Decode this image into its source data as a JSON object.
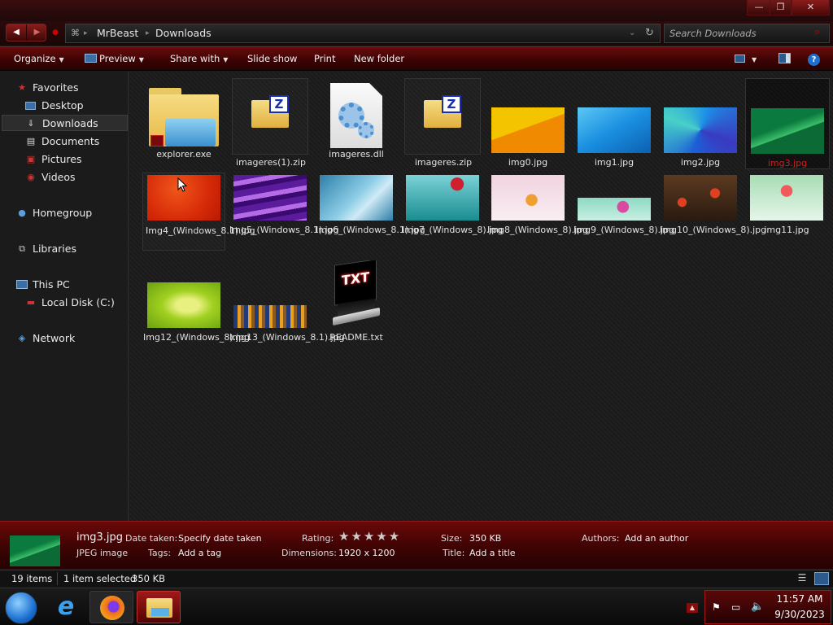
{
  "window": {
    "minimize_label": "—",
    "maximize_label": "❐",
    "close_label": "✕"
  },
  "address": {
    "crumbs": [
      "MrBeast",
      "Downloads"
    ],
    "search_placeholder": "Search Downloads"
  },
  "toolbar": {
    "organize": "Organize",
    "preview": "Preview",
    "share_with": "Share with",
    "slide_show": "Slide show",
    "print": "Print",
    "new_folder": "New folder"
  },
  "nav": {
    "favorites": "Favorites",
    "desktop": "Desktop",
    "downloads": "Downloads",
    "documents": "Documents",
    "pictures": "Pictures",
    "videos": "Videos",
    "homegroup": "Homegroup",
    "libraries": "Libraries",
    "this_pc": "This PC",
    "local_disk": "Local Disk (C:)",
    "network": "Network"
  },
  "files": [
    {
      "name": "explorer.exe",
      "kind": "folder-icon"
    },
    {
      "name": "imageres(1).zip",
      "kind": "zip-icon"
    },
    {
      "name": "imageres.dll",
      "kind": "dll-icon"
    },
    {
      "name": "imageres.zip",
      "kind": "zip-icon"
    },
    {
      "name": "img0.jpg",
      "kind": "image",
      "colors": [
        "#f5c400",
        "#f08a00"
      ]
    },
    {
      "name": "img1.jpg",
      "kind": "image",
      "colors": [
        "#1a8fe0",
        "#5cc8f5"
      ]
    },
    {
      "name": "img2.jpg",
      "kind": "image",
      "colors": [
        "#1c5fd6",
        "#49d0c7"
      ]
    },
    {
      "name": "img3.jpg",
      "kind": "image",
      "colors": [
        "#0b7a3e",
        "#3bbf6a"
      ]
    },
    {
      "name": "Img4_(Windows_8.1).jpg",
      "kind": "image",
      "colors": [
        "#d62a08",
        "#f0561a"
      ]
    },
    {
      "name": "Img5_(Windows_8.1).jpg",
      "kind": "image",
      "colors": [
        "#5a1c9c",
        "#b56be6"
      ]
    },
    {
      "name": "Img6_(Windows_8.1).jpg",
      "kind": "image",
      "colors": [
        "#8fcfe8",
        "#2e7fa8"
      ]
    },
    {
      "name": "Img7_(Windows_8).jpg",
      "kind": "image",
      "colors": [
        "#1a8c90",
        "#7bd2d6"
      ]
    },
    {
      "name": "Img8_(Windows_8).jpg",
      "kind": "image",
      "colors": [
        "#f2d3e0",
        "#f0a030"
      ]
    },
    {
      "name": "Img9_(Windows_8).jpg",
      "kind": "image",
      "colors": [
        "#8fd9c4",
        "#d84aa0"
      ]
    },
    {
      "name": "Img10_(Windows_8).jpg",
      "kind": "image",
      "colors": [
        "#5c3a20",
        "#b83018"
      ]
    },
    {
      "name": "img11.jpg",
      "kind": "image",
      "colors": [
        "#d0ecd8",
        "#f05a5a"
      ]
    },
    {
      "name": "Img12_(Windows_8).jpg",
      "kind": "image",
      "colors": [
        "#a0d020",
        "#e8f080"
      ]
    },
    {
      "name": "Img13_(Windows_8.1).jpg",
      "kind": "image",
      "colors": [
        "#203a7a",
        "#e8a020"
      ]
    },
    {
      "name": "README.txt",
      "kind": "txt-icon",
      "badge": "TXT"
    }
  ],
  "details": {
    "filename": "img3.jpg",
    "filetype": "JPEG image",
    "date_taken_label": "Date taken:",
    "date_taken_value": "Specify date taken",
    "tags_label": "Tags:",
    "tags_value": "Add a tag",
    "rating_label": "Rating:",
    "rating_stars": "★★★★★",
    "dimensions_label": "Dimensions:",
    "dimensions_value": "1920 x 1200",
    "size_label": "Size:",
    "size_value": "350 KB",
    "title_label": "Title:",
    "title_value": "Add a title",
    "authors_label": "Authors:",
    "authors_value": "Add an author"
  },
  "status": {
    "count": "19 items",
    "selected": "1 item selected",
    "size": "350 KB"
  },
  "clock": {
    "time": "11:57 AM",
    "date": "9/30/2023"
  },
  "colors": {
    "accent": "#8b0a0a",
    "selected_text": "#c92020"
  }
}
